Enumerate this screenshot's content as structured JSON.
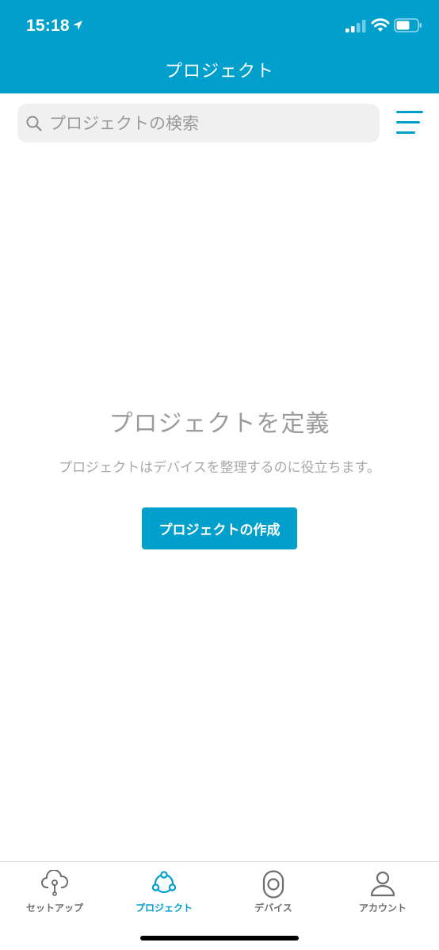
{
  "status_bar": {
    "time": "15:18"
  },
  "header": {
    "title": "プロジェクト"
  },
  "search": {
    "placeholder": "プロジェクトの検索",
    "value": ""
  },
  "empty_state": {
    "title": "プロジェクトを定義",
    "description": "プロジェクトはデバイスを整理するのに役立ちます。",
    "button_label": "プロジェクトの作成"
  },
  "tabs": [
    {
      "label": "セットアップ",
      "icon": "cloud-setup-icon",
      "active": false
    },
    {
      "label": "プロジェクト",
      "icon": "project-network-icon",
      "active": true
    },
    {
      "label": "デバイス",
      "icon": "device-icon",
      "active": false
    },
    {
      "label": "アカウント",
      "icon": "account-icon",
      "active": false
    }
  ],
  "colors": {
    "accent": "#009fcc",
    "inactive": "#6e6e6e",
    "muted_text": "#9b9b9b"
  }
}
